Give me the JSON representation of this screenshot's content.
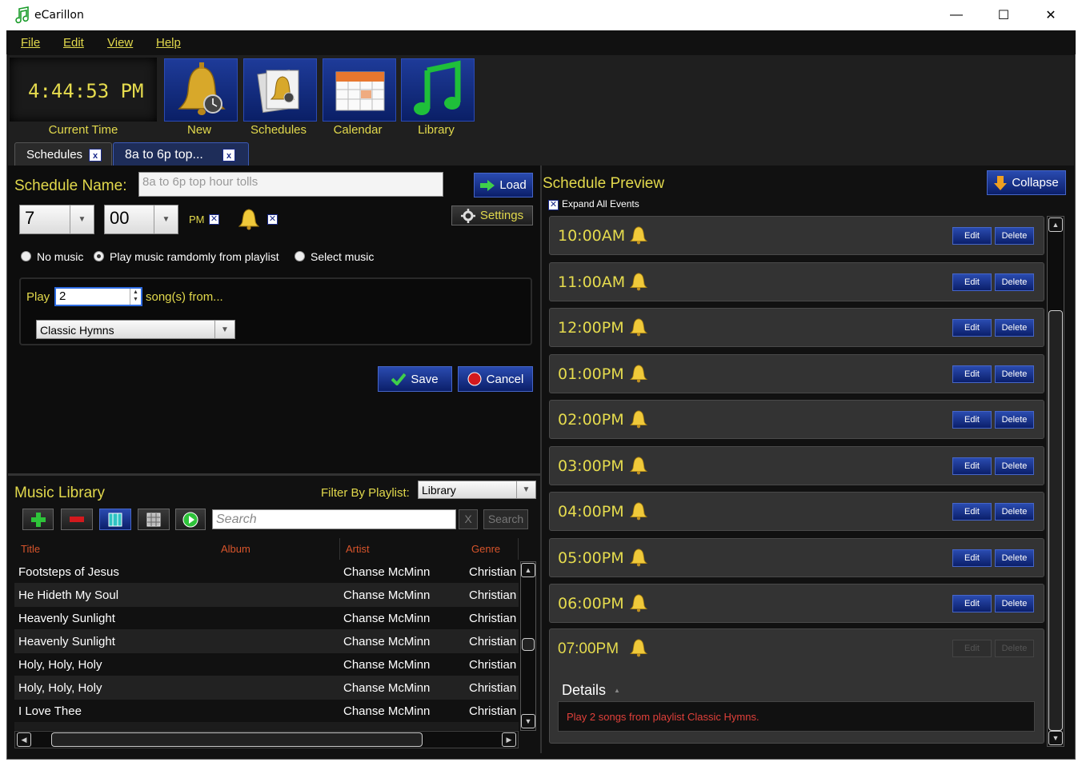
{
  "window": {
    "title": "eCarillon",
    "minimize": "—",
    "maximize": "☐",
    "close": "✕"
  },
  "menu": [
    "File",
    "Edit",
    "View",
    "Help"
  ],
  "toolbar": {
    "clock": "4:44:53 PM",
    "clock_label": "Current Time",
    "buttons": [
      "New",
      "Schedules",
      "Calendar",
      "Library"
    ]
  },
  "tabs": [
    {
      "label": "Schedules",
      "close": "x"
    },
    {
      "label": "8a to 6p top...",
      "close": "x"
    }
  ],
  "schedule_form": {
    "name_label": "Schedule Name:",
    "name_value": "8a to 6p top hour tolls",
    "load_button": "Load",
    "hour": "7",
    "minute": "00",
    "ampm": "PM",
    "settings_button": "Settings",
    "music_options": [
      "No music",
      "Play music ramdomly from playlist",
      "Select music"
    ],
    "selected_option": 1,
    "play_label": "Play",
    "song_count": "2",
    "songs_from_label": "song(s) from...",
    "playlist": "Classic Hymns",
    "save_button": "Save",
    "cancel_button": "Cancel"
  },
  "library": {
    "title": "Music Library",
    "filter_label": "Filter By Playlist:",
    "filter_value": "Library",
    "search_placeholder": "Search",
    "clear_button": "X",
    "search_button": "Search",
    "columns": [
      "Title",
      "Album",
      "Artist",
      "Genre"
    ],
    "rows": [
      {
        "title": "Footsteps of Jesus",
        "album": "",
        "artist": "Chanse McMinn",
        "genre": "Christian"
      },
      {
        "title": "He Hideth My Soul",
        "album": "",
        "artist": "Chanse McMinn",
        "genre": "Christian"
      },
      {
        "title": "Heavenly Sunlight",
        "album": "",
        "artist": "Chanse McMinn",
        "genre": "Christian"
      },
      {
        "title": "Heavenly Sunlight",
        "album": "",
        "artist": "Chanse McMinn",
        "genre": "Christian"
      },
      {
        "title": "Holy, Holy, Holy",
        "album": "",
        "artist": "Chanse McMinn",
        "genre": "Christian"
      },
      {
        "title": "Holy, Holy, Holy",
        "album": "",
        "artist": "Chanse McMinn",
        "genre": "Christian"
      },
      {
        "title": "I Love Thee",
        "album": "",
        "artist": "Chanse McMinn",
        "genre": "Christian"
      }
    ]
  },
  "preview": {
    "title": "Schedule Preview",
    "collapse_button": "Collapse",
    "expand_label": "Expand All Events",
    "edit_label": "Edit",
    "delete_label": "Delete",
    "events": [
      "10:00AM",
      "11:00AM",
      "12:00PM",
      "01:00PM",
      "02:00PM",
      "03:00PM",
      "04:00PM",
      "05:00PM",
      "06:00PM",
      "07:00PM"
    ],
    "details_label": "Details",
    "details_text": "Play 2 songs from playlist Classic Hymns."
  },
  "colors": {
    "accent": "#e2d94c",
    "button_blue": "#1e3b99",
    "header_orange": "#d7542b",
    "details_red": "#e0403a"
  }
}
